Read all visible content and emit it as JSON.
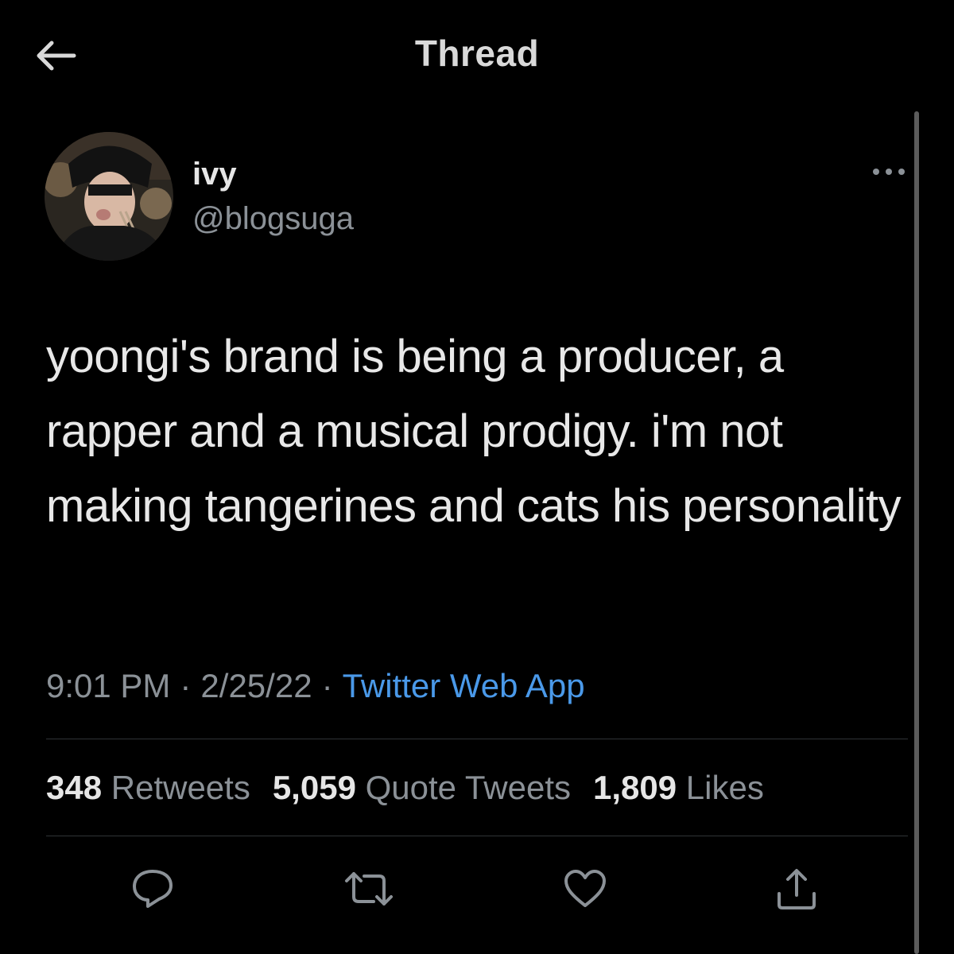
{
  "header": {
    "title": "Thread",
    "back_icon": "arrow-left-icon"
  },
  "tweet": {
    "author": {
      "display_name": "ivy",
      "handle": "@blogsuga"
    },
    "text": "yoongi's brand is being a producer, a rapper and a musical prodigy. i'm not making tangerines and cats his personality",
    "time": "9:01 PM",
    "date": "2/25/22",
    "separator": "·",
    "source": "Twitter Web App",
    "stats": {
      "retweets": {
        "count": "348",
        "label": "Retweets"
      },
      "quotes": {
        "count": "5,059",
        "label": "Quote Tweets"
      },
      "likes": {
        "count": "1,809",
        "label": "Likes"
      }
    }
  },
  "actions": [
    "reply-icon",
    "retweet-icon",
    "like-icon",
    "share-icon"
  ],
  "colors": {
    "background": "#000000",
    "text": "#e8e8e8",
    "secondary": "#8b9197",
    "link": "#4a99e9",
    "divider": "#2f3336"
  }
}
